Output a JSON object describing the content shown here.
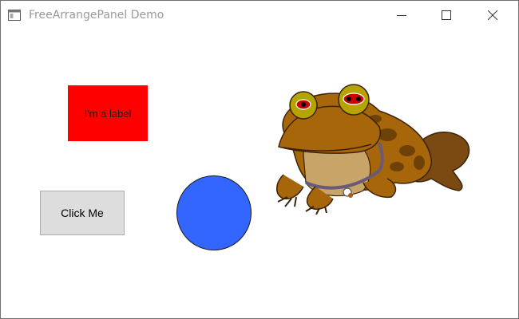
{
  "window": {
    "title": "FreeArrangePanel Demo"
  },
  "titlebar": {
    "icons": [
      "app-window-icon",
      "minimize-icon",
      "maximize-icon",
      "close-icon"
    ]
  },
  "content": {
    "label": {
      "text": "I'm a label",
      "background": "#ff0000"
    },
    "button": {
      "label": "Click Me"
    },
    "circle": {
      "color": "#3366ff"
    },
    "image": {
      "subject": "hypnotoad-frog"
    }
  }
}
